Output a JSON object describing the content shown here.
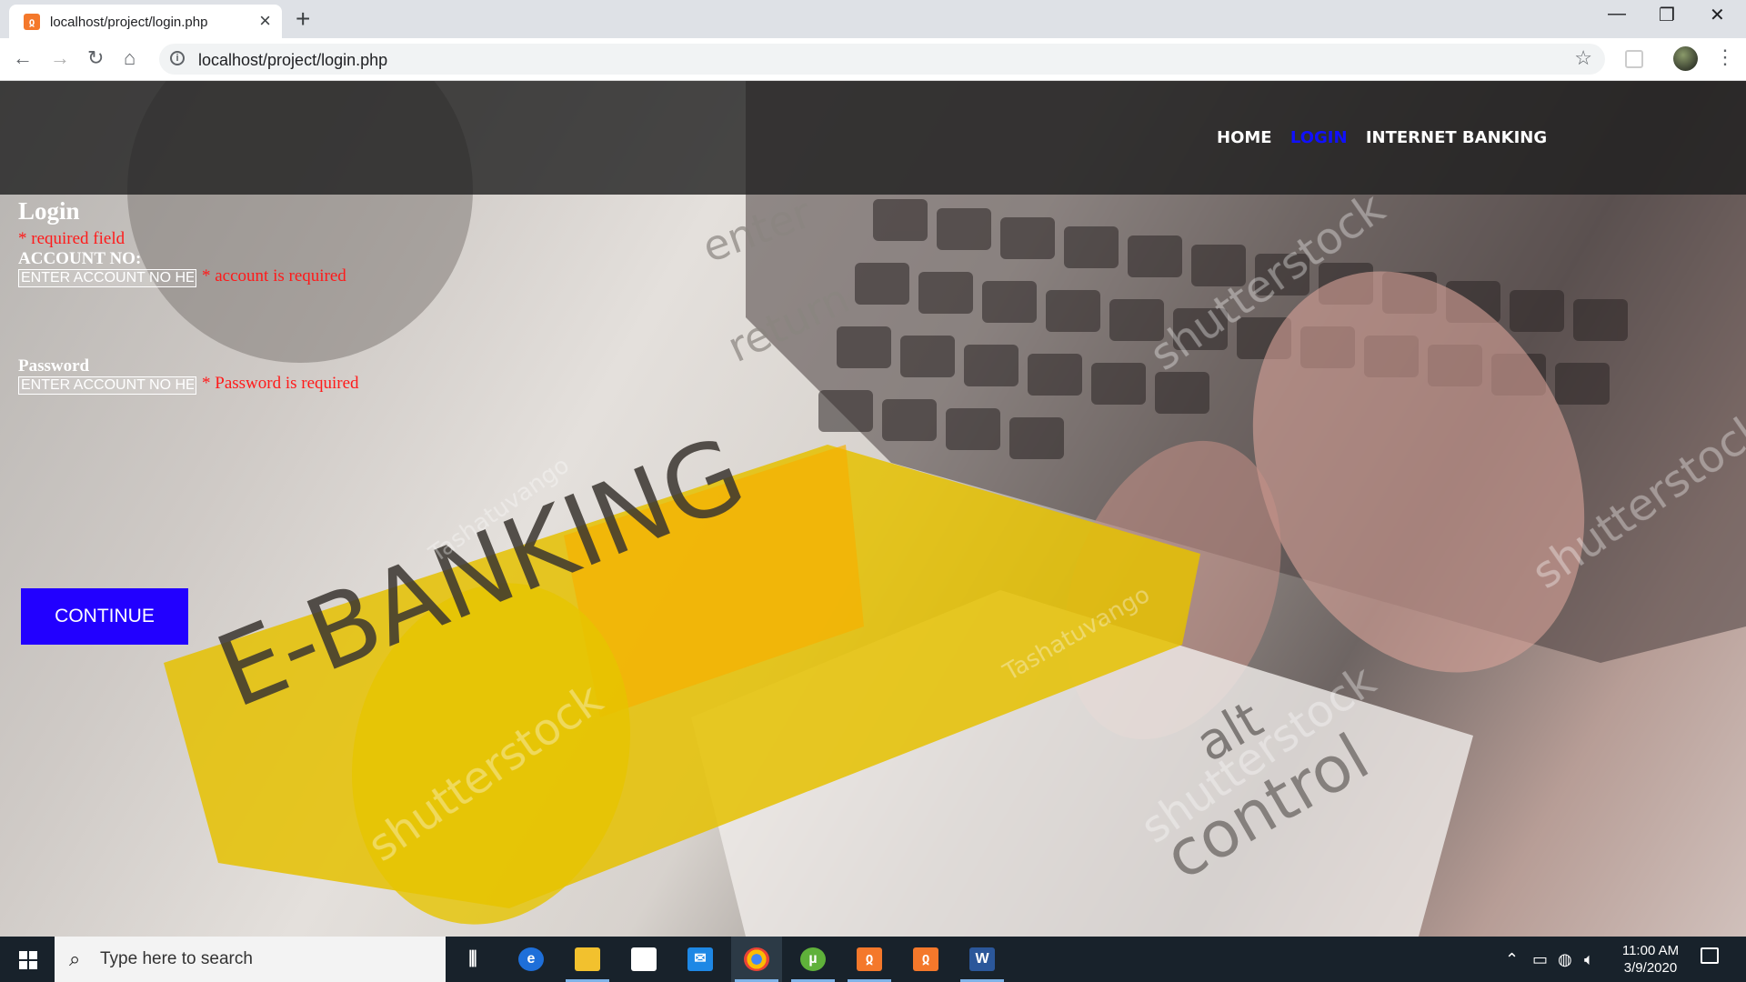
{
  "browser": {
    "tab_title": "localhost/project/login.php",
    "url": "localhost/project/login.php"
  },
  "nav": {
    "home": "HOME",
    "login": "LOGIN",
    "internet_banking": "INTERNET BANKING"
  },
  "form": {
    "title": "Login",
    "required_note": "* required field",
    "account_label": "ACCOUNT NO:",
    "account_placeholder": "ENTER ACCOUNT NO HERE",
    "account_error": "* account is required",
    "password_label": "Password",
    "password_placeholder": "ENTER ACCOUNT NO HERE",
    "password_error": "* Password is required",
    "continue_label": "CONTINUE"
  },
  "background_image": {
    "sign_text": "E-BANKING",
    "key_text_alt": "alt",
    "key_text_control": "control",
    "key_text_enter": "enter",
    "key_text_return": "return",
    "watermark": "shutterstock",
    "credit": "Tashatuvango"
  },
  "taskbar": {
    "search_placeholder": "Type here to search",
    "time": "11:00 AM",
    "date": "3/9/2020",
    "apps": [
      "task-view",
      "edge",
      "file-explorer",
      "store",
      "mail",
      "chrome",
      "utorrent",
      "xampp",
      "xampp",
      "word"
    ]
  },
  "colors": {
    "accent_blue": "#2200ff",
    "error_red": "#ff1a1a",
    "nav_login": "#1010ff"
  }
}
